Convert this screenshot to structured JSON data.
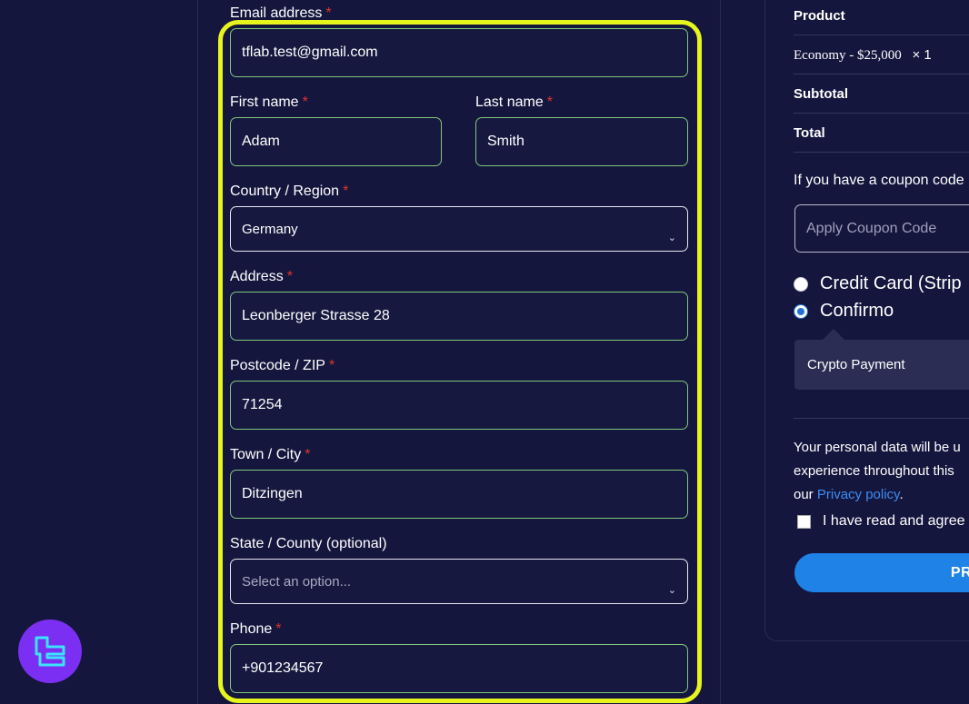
{
  "form": {
    "email": {
      "label": "Email address",
      "value": "tflab.test@gmail.com"
    },
    "first_name": {
      "label": "First name",
      "value": "Adam"
    },
    "last_name": {
      "label": "Last name",
      "value": "Smith"
    },
    "country": {
      "label": "Country / Region",
      "value": "Germany"
    },
    "address": {
      "label": "Address",
      "value": "Leonberger Strasse 28"
    },
    "postcode": {
      "label": "Postcode / ZIP",
      "value": "71254"
    },
    "city": {
      "label": "Town / City",
      "value": "Ditzingen"
    },
    "state": {
      "label": "State / County (optional)",
      "placeholder": "Select an option..."
    },
    "phone": {
      "label": "Phone",
      "value": "+901234567"
    },
    "required_mark": "*"
  },
  "summary": {
    "product_header": "Product",
    "product_line": "Economy - $25,000",
    "product_qty": "× 1",
    "subtotal_label": "Subtotal",
    "total_label": "Total",
    "coupon_prompt": "If you have a coupon code",
    "coupon_placeholder": "Apply Coupon Code",
    "payment_methods": [
      {
        "label": "Credit Card (Strip",
        "selected": false
      },
      {
        "label": "Confirmo",
        "selected": true
      }
    ],
    "crypto_payment": "Crypto Payment",
    "privacy_line1": "Your personal data will be u",
    "privacy_line2": "experience throughout this",
    "privacy_line3_prefix": "our",
    "privacy_link": "Privacy policy",
    "privacy_period": ".",
    "agree_text": "I have read and agree",
    "proceed_label": "PRO"
  },
  "colors": {
    "background": "#15163e",
    "highlight": "#e6f51c",
    "field_border": "#7fc77a",
    "required": "#e0342c",
    "button": "#1e82e6",
    "link": "#3c8df0",
    "logo": "#7b2ff2"
  },
  "icons": {
    "logo": "tf-logo-icon",
    "select_arrow": "chevron-down-icon"
  }
}
